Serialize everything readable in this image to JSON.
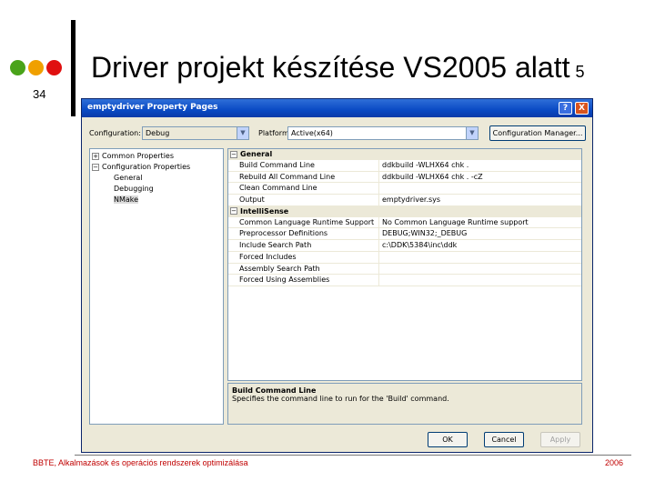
{
  "slide": {
    "number": "34",
    "title": "Driver projekt készítése VS2005 alatt",
    "title_suffix": "5",
    "footer_left": "BBTE, Alkalmazások és operációs rendszerek optimizálása",
    "footer_right": "2006"
  },
  "dialog": {
    "title": "emptydriver Property Pages",
    "help_btn": "?",
    "close_btn": "X",
    "configuration_label": "Configuration:",
    "configuration_value": "Debug",
    "platform_label": "Platform:",
    "platform_value": "Active(x64)",
    "config_manager_label": "Configuration Manager...",
    "tree": [
      {
        "label": "Common Properties",
        "expander": "+"
      },
      {
        "label": "Configuration Properties",
        "expander": "−"
      },
      {
        "label": "General"
      },
      {
        "label": "Debugging"
      },
      {
        "label": "NMake"
      }
    ],
    "categories": [
      {
        "name": "General",
        "expander": "−",
        "rows": [
          {
            "name": "Build Command Line",
            "value": "ddkbuild -WLHX64 chk ."
          },
          {
            "name": "Rebuild All Command Line",
            "value": "ddkbuild -WLHX64 chk . -cZ"
          },
          {
            "name": "Clean Command Line",
            "value": ""
          },
          {
            "name": "Output",
            "value": "emptydriver.sys"
          }
        ]
      },
      {
        "name": "IntelliSense",
        "expander": "−",
        "rows": [
          {
            "name": "Common Language Runtime Support",
            "value": "No Common Language Runtime support"
          },
          {
            "name": "Preprocessor Definitions",
            "value": "DEBUG;WIN32;_DEBUG"
          },
          {
            "name": "Include Search Path",
            "value": "c:\\DDK\\5384\\inc\\ddk"
          },
          {
            "name": "Forced Includes",
            "value": ""
          },
          {
            "name": "Assembly Search Path",
            "value": ""
          },
          {
            "name": "Forced Using Assemblies",
            "value": ""
          }
        ]
      }
    ],
    "description_title": "Build Command Line",
    "description_text": "Specifies the command line to run for the 'Build' command.",
    "ok_label": "OK",
    "cancel_label": "Cancel",
    "apply_label": "Apply"
  }
}
